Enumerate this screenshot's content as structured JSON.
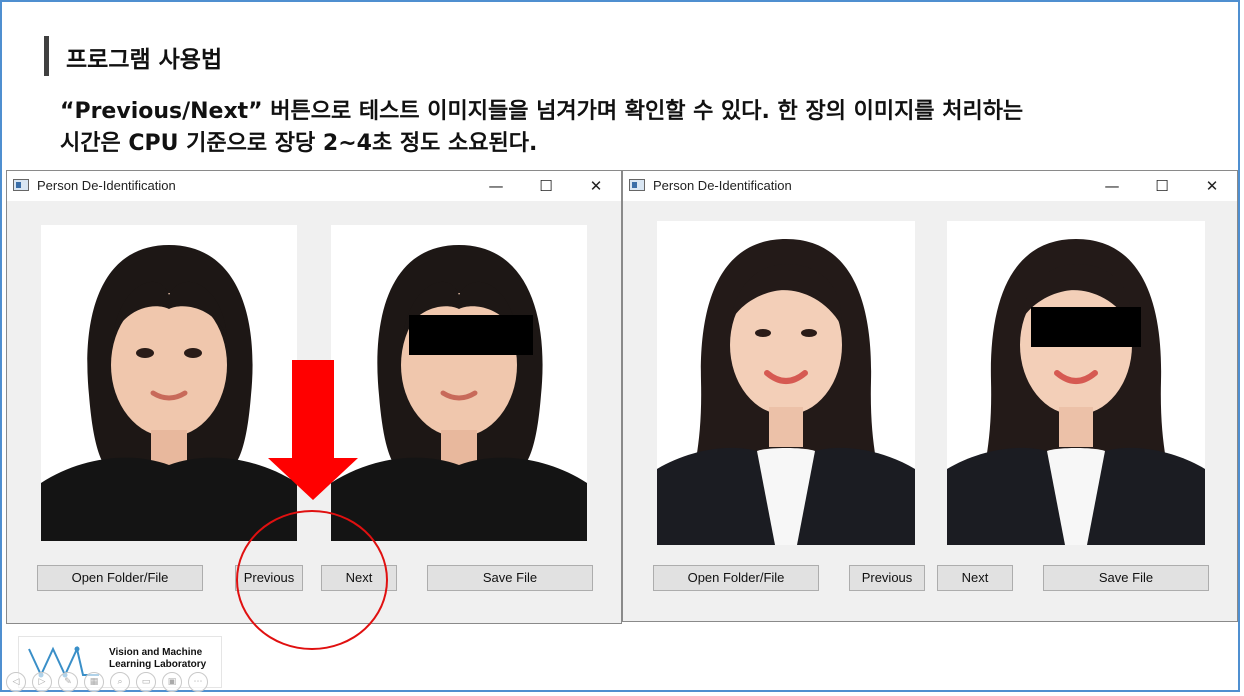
{
  "slide": {
    "title": "프로그램 사용법",
    "description_line1": "“Previous/Next” 버튼으로 테스트 이미지들을 넘겨가며 확인할 수 있다. 한 장의 이미지를 처리하는",
    "description_line2": "시간은 CPU 기준으로 장당 2~4초 정도 소요된다."
  },
  "windows": [
    {
      "title": "Person De-Identification",
      "controls": {
        "minimize": "—",
        "maximize": "☐",
        "close": "✕"
      },
      "buttons": {
        "open": "Open Folder/File",
        "previous": "Previous",
        "next": "Next",
        "save": "Save File"
      }
    },
    {
      "title": "Person De-Identification",
      "controls": {
        "minimize": "—",
        "maximize": "☐",
        "close": "✕"
      },
      "buttons": {
        "open": "Open Folder/File",
        "previous": "Previous",
        "next": "Next",
        "save": "Save File"
      }
    }
  ],
  "logo": {
    "line1": "Vision and Machine",
    "line2": "Learning Laboratory"
  },
  "colors": {
    "accent_red": "#ff0000",
    "frame_blue": "#4f8fd0",
    "window_bg": "#f0f0f0",
    "censor_bar": "#000000"
  }
}
